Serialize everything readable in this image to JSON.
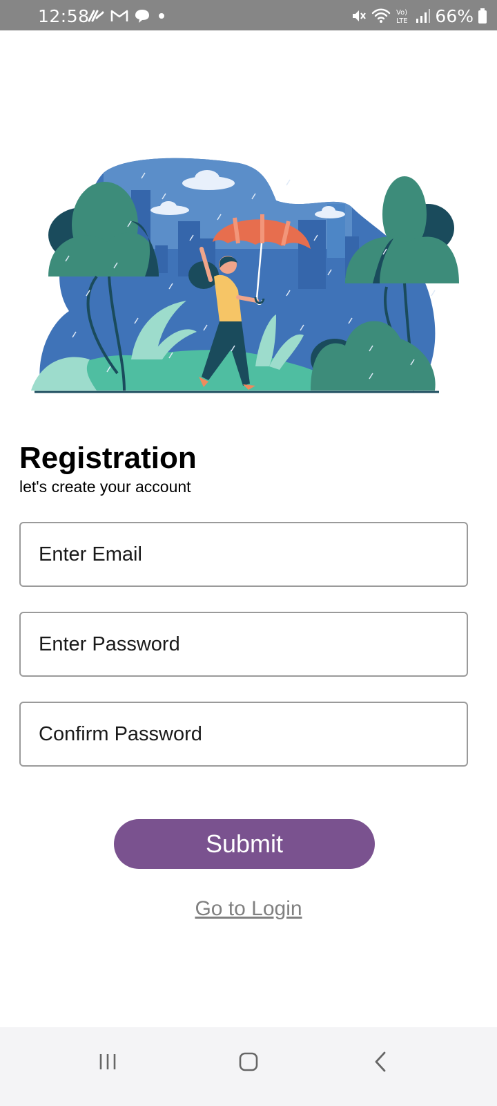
{
  "status_bar": {
    "time": "12:58",
    "battery": "66%",
    "left_icons": [
      "app-notification-icon",
      "gmail-icon",
      "chat-bubble-icon",
      "dot-icon"
    ],
    "right_icons": [
      "mute-icon",
      "wifi-icon",
      "volte-icon",
      "signal-icon",
      "battery-icon"
    ]
  },
  "illustration": {
    "description_icon": "woman-with-umbrella-in-rain-illustration"
  },
  "header": {
    "title": "Registration",
    "subtitle": "let's create your account"
  },
  "form": {
    "email_placeholder": "Enter Email",
    "password_placeholder": "Enter Password",
    "confirm_placeholder": "Confirm Password",
    "submit_label": "Submit",
    "login_link": "Go to Login"
  },
  "nav_bar": {
    "buttons": [
      "recent-apps-icon",
      "home-icon",
      "back-icon"
    ]
  },
  "colors": {
    "status_bar": "#868686",
    "accent": "#7a528f",
    "link": "#808080",
    "nav_bar": "#f4f4f6"
  }
}
